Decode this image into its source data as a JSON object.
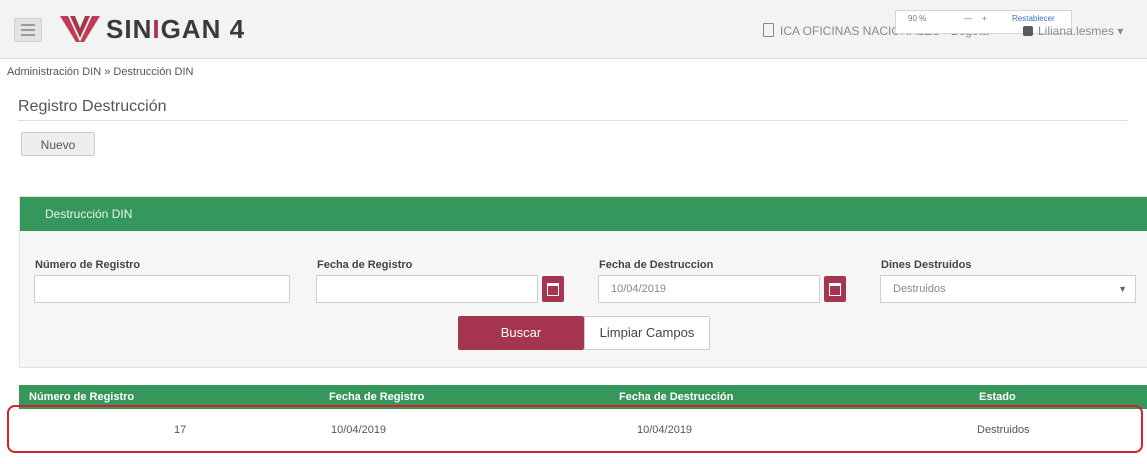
{
  "header": {
    "logo_text_a": "SIN",
    "logo_text_b": "I",
    "logo_text_c": "GAN",
    "logo_version": "4",
    "office": "ICA OFICINAS NACIONALES - Bogota",
    "user": "Liliana.lesmes",
    "zoom": {
      "percent": "90 %",
      "minus": "—",
      "plus": "+",
      "reset": "Restablecer"
    }
  },
  "breadcrumb": "Administración DIN » Destrucción DIN",
  "page_title": "Registro Destrucción",
  "toolbar": {
    "nuevo_label": "Nuevo"
  },
  "panel": {
    "title": "Destrucción DIN",
    "fields": [
      {
        "label": "Número de Registro",
        "value": ""
      },
      {
        "label": "Fecha de Registro",
        "value": ""
      },
      {
        "label": "Fecha de Destruccion",
        "value": "10/04/2019"
      },
      {
        "label": "Dines Destruidos",
        "value": "Destruidos"
      }
    ],
    "buscar_label": "Buscar",
    "limpiar_label": "Limpiar Campos"
  },
  "table": {
    "columns": [
      "Número de Registro",
      "Fecha de Registro",
      "Fecha de Destrucción",
      "Estado"
    ],
    "rows": [
      [
        "17",
        "10/04/2019",
        "10/04/2019",
        "Destruidos"
      ]
    ]
  },
  "colors": {
    "brand_green": "#35975b",
    "brand_maroon": "#a6354f",
    "highlight_red": "#d6212a"
  },
  "icons": [
    "hamburger-menu-icon",
    "sinigan-logo-icon",
    "office-icon",
    "user-icon",
    "calendar-icon",
    "dropdown-arrow-icon"
  ]
}
